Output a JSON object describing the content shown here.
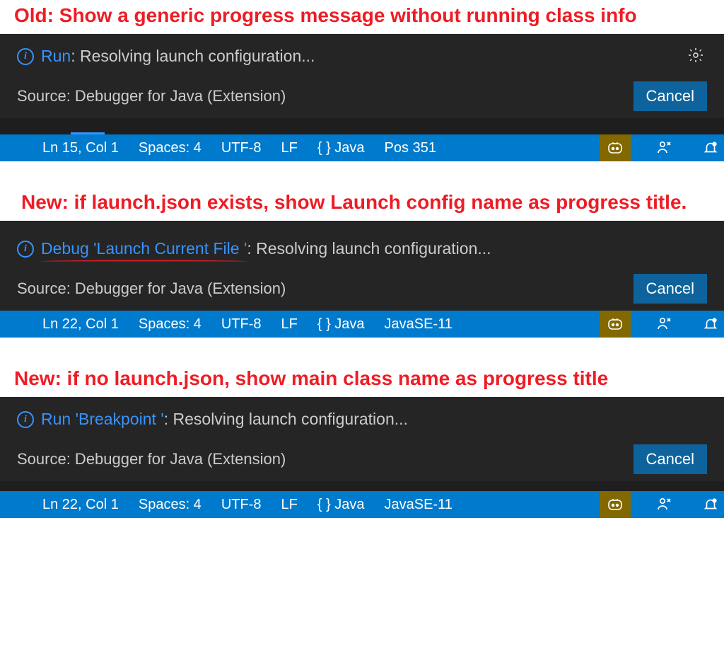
{
  "captions": {
    "c1": "Old: Show a generic progress message without running class info",
    "c2": "New: if launch.json exists, show Launch config name as progress title.",
    "c3": "New: if no launch.json, show main class name as progress title"
  },
  "notif1": {
    "prefix": "Run",
    "title_rest": ": Resolving launch configuration...",
    "source": "Source: Debugger for Java (Extension)",
    "cancel": "Cancel"
  },
  "notif2": {
    "prefix": "Debug 'Launch Current File '",
    "title_rest": ": Resolving launch configuration...",
    "source": "Source: Debugger for Java (Extension)",
    "cancel": "Cancel"
  },
  "notif3": {
    "prefix": "Run 'Breakpoint '",
    "title_rest": ": Resolving launch configuration...",
    "source": "Source: Debugger for Java (Extension)",
    "cancel": "Cancel"
  },
  "status1": {
    "ln": "Ln 15, Col 1",
    "spaces": "Spaces: 4",
    "enc": "UTF-8",
    "eol": "LF",
    "lang": "{ }  Java",
    "extra": "Pos 351"
  },
  "status2": {
    "ln": "Ln 22, Col 1",
    "spaces": "Spaces: 4",
    "enc": "UTF-8",
    "eol": "LF",
    "lang": "{ }  Java",
    "extra": "JavaSE-11"
  },
  "status3": {
    "ln": "Ln 22, Col 1",
    "spaces": "Spaces: 4",
    "enc": "UTF-8",
    "eol": "LF",
    "lang": "{ }  Java",
    "extra": "JavaSE-11"
  }
}
